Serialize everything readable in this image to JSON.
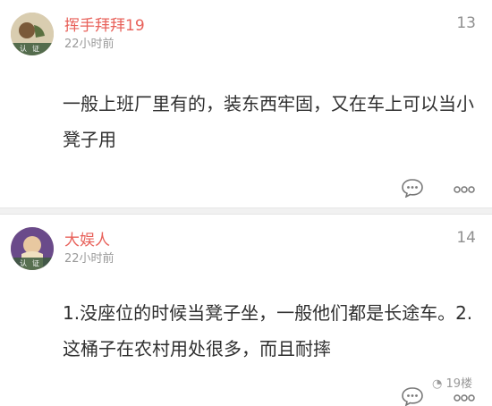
{
  "comments": [
    {
      "username": "挥手拜拜19",
      "time": "22小时前",
      "floor": "13",
      "badge": "认证",
      "content": "一般上班厂里有的，装东西牢固，又在车上可以当小凳子用"
    },
    {
      "username": "大娱人",
      "time": "22小时前",
      "floor": "14",
      "badge": "认证",
      "content": "1.没座位的时候当凳子坐，一般他们都是长途车。2.这桶子在农村用处很多，而且耐摔"
    }
  ],
  "watermark": "19楼",
  "colors": {
    "username": "#e8615a",
    "meta": "#9a9a9a",
    "text": "#2f2f2f"
  },
  "icons": [
    "comment-icon",
    "more-icon"
  ]
}
